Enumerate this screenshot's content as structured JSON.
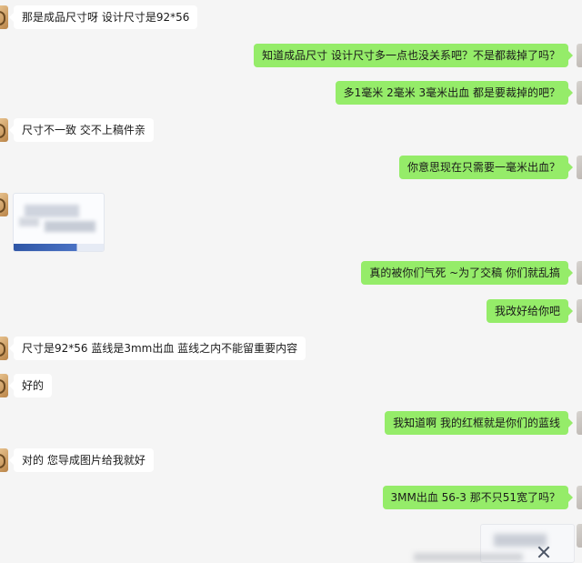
{
  "messages": [
    {
      "side": "left",
      "text": "那是成品尺寸呀 设计尺寸是92*56"
    },
    {
      "side": "right",
      "text": "知道成品尺寸  设计尺寸多一点也没关系吧？不是都裁掉了吗？"
    },
    {
      "side": "right",
      "text": "多1毫米  2毫米  3毫米出血 都是要裁掉的吧？"
    },
    {
      "side": "left",
      "text": "尺寸不一致 交不上稿件亲"
    },
    {
      "side": "right",
      "text": "你意思现在只需要一毫米出血？"
    },
    {
      "side": "left",
      "kind": "image"
    },
    {
      "side": "right",
      "text": "真的被你们气死 ~为了交稿  你们就乱搞"
    },
    {
      "side": "right",
      "text": "我改好给你吧"
    },
    {
      "side": "left",
      "text": "尺寸是92*56    蓝线是3mm出血      蓝线之内不能留重要内容"
    },
    {
      "side": "left",
      "text": "好的"
    },
    {
      "side": "right",
      "text": "我知道啊  我的红框就是你们的蓝线"
    },
    {
      "side": "left",
      "text": "对的  您导成图片给我就好"
    },
    {
      "side": "right",
      "text": "3MM出血  56-3  那不只51宽了吗？"
    },
    {
      "side": "right",
      "kind": "image"
    }
  ],
  "colors": {
    "background": "#f5f5f5",
    "bubble_left": "#ffffff",
    "bubble_right": "#95ec69"
  }
}
